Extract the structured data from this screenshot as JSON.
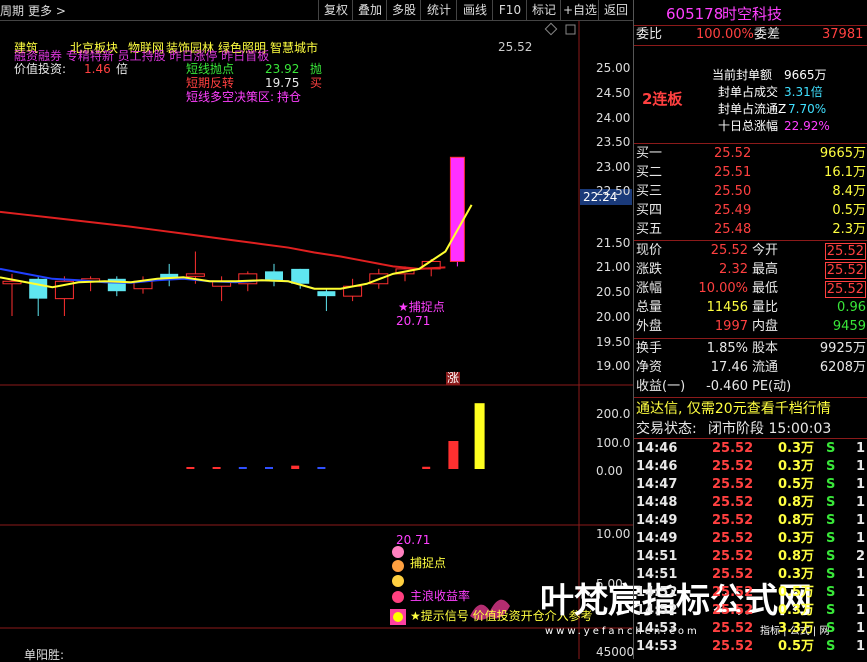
{
  "topbar": {
    "left_items": [
      "周期",
      "更多 >"
    ],
    "buttons": [
      "复权",
      "叠加",
      "多股",
      "统计",
      "画线",
      "F10",
      "标记",
      "+自选",
      "返回"
    ]
  },
  "main": {
    "sector_labels": [
      "建筑",
      "北京板块",
      "物联网",
      "装饰园林",
      "绿色照明",
      "智慧城市"
    ],
    "overlap_text": "融资融券 专精特新 员工持股 昨日涨停 昨日首板",
    "value_invest_label": "价值投资:",
    "value_invest_val": "1.46",
    "value_invest_unit": "倍",
    "sig1_label": "短线抛点",
    "sig1_val": "23.92",
    "sig1_act": "抛",
    "sig2_label": "短期反转",
    "sig2_val": "19.75",
    "sig2_act": "买",
    "sig3_label": "短线多空决策区:",
    "sig3_val": "持仓",
    "corner_price": "25.52",
    "price_axis": [
      "25.00",
      "24.50",
      "24.00",
      "23.50",
      "23.00",
      "22.50",
      "22.24",
      "21.50",
      "21.00",
      "20.50",
      "20.00",
      "19.50",
      "19.00"
    ],
    "catch_label": "★捕捉点",
    "catch_val": "20.71",
    "zhang": "涨",
    "vol_axis": [
      "200.0",
      "100.0",
      "0.00"
    ],
    "lower_axis": [
      "10.00",
      "5.00",
      "45000"
    ],
    "lower_val": "20.71",
    "lower_catch": "捕捉点",
    "lower_income": "主浪收益率",
    "lower_signal": "★提示信号 价值投资开仓介入参考",
    "bottom_left": "单阳胜:",
    "watermark": "叶梵宸指标公式网",
    "watermark_url": "www.yefanchen.com",
    "watermark_sub": "指标 | 公式 | 网"
  },
  "chart_data": {
    "type": "candlestick",
    "candles": [
      {
        "o": 20.7,
        "c": 20.65,
        "h": 20.85,
        "l": 20.0,
        "color": "red"
      },
      {
        "o": 20.75,
        "c": 20.35,
        "h": 20.8,
        "l": 20.0,
        "color": "cyan"
      },
      {
        "o": 20.35,
        "c": 20.7,
        "h": 20.8,
        "l": 20.0,
        "color": "red"
      },
      {
        "o": 20.7,
        "c": 20.75,
        "h": 20.8,
        "l": 20.5,
        "color": "red"
      },
      {
        "o": 20.75,
        "c": 20.5,
        "h": 20.8,
        "l": 20.4,
        "color": "cyan"
      },
      {
        "o": 20.55,
        "c": 20.7,
        "h": 20.8,
        "l": 20.45,
        "color": "red"
      },
      {
        "o": 20.75,
        "c": 20.85,
        "h": 21.05,
        "l": 20.6,
        "color": "cyan"
      },
      {
        "o": 20.8,
        "c": 20.85,
        "h": 21.3,
        "l": 20.65,
        "color": "red"
      },
      {
        "o": 20.7,
        "c": 20.6,
        "h": 20.8,
        "l": 20.3,
        "color": "red"
      },
      {
        "o": 20.65,
        "c": 20.85,
        "h": 20.9,
        "l": 20.5,
        "color": "red"
      },
      {
        "o": 20.9,
        "c": 20.7,
        "h": 21.05,
        "l": 20.6,
        "color": "cyan"
      },
      {
        "o": 20.95,
        "c": 20.65,
        "h": 20.95,
        "l": 20.55,
        "color": "cyan"
      },
      {
        "o": 20.5,
        "c": 20.4,
        "h": 20.55,
        "l": 20.1,
        "color": "cyan"
      },
      {
        "o": 20.4,
        "c": 20.6,
        "h": 20.75,
        "l": 20.3,
        "color": "red"
      },
      {
        "o": 20.65,
        "c": 20.85,
        "h": 20.95,
        "l": 20.55,
        "color": "red"
      },
      {
        "o": 20.85,
        "c": 20.95,
        "h": 21.0,
        "l": 20.7,
        "color": "red"
      },
      {
        "o": 20.95,
        "c": 21.1,
        "h": 21.15,
        "l": 20.8,
        "color": "red"
      },
      {
        "o": 21.1,
        "c": 23.2,
        "h": 23.2,
        "l": 21.0,
        "color": "mag"
      }
    ],
    "ma_red": [
      22.1,
      22.04,
      21.98,
      21.92,
      21.86,
      21.8,
      21.73,
      21.66,
      21.59,
      21.52,
      21.45,
      21.38,
      21.28,
      21.2,
      21.1,
      21.0,
      20.95,
      20.98
    ],
    "ma_yellow": [
      20.78,
      20.68,
      20.58,
      20.68,
      20.7,
      20.68,
      20.75,
      20.78,
      20.7,
      20.7,
      20.72,
      20.7,
      20.55,
      20.55,
      20.65,
      20.85,
      20.95,
      21.3,
      22.24
    ],
    "ma_blue": [
      20.95,
      20.85,
      20.75,
      20.72,
      20.68,
      20.67,
      20.72,
      20.75,
      20.7,
      20.68,
      20.72,
      20.7,
      20.55
    ],
    "vol_bars": [
      {
        "i": 7,
        "v": 6,
        "color": "red"
      },
      {
        "i": 8,
        "v": 4,
        "color": "red"
      },
      {
        "i": 9,
        "v": 2,
        "color": "blue"
      },
      {
        "i": 10,
        "v": 4,
        "color": "blue"
      },
      {
        "i": 11,
        "v": 12,
        "color": "red"
      },
      {
        "i": 12,
        "v": 6,
        "color": "blue"
      },
      {
        "i": 16,
        "v": 8,
        "color": "red"
      },
      {
        "i": 17,
        "v": 100,
        "color": "red"
      },
      {
        "i": 18,
        "v": 235,
        "color": "yellow"
      }
    ]
  },
  "right_panel": {
    "code": "605178",
    "name": "时空科技",
    "weibi_label": "委比",
    "weibi_val": "100.00%",
    "weicha_label": "委差",
    "weicha_val": "37981",
    "lianban": "2连板",
    "stats": [
      {
        "label": "当前封单额",
        "val": "9665万"
      },
      {
        "label": "封单占成交",
        "val": "3.31倍"
      },
      {
        "label": "封单占流通Z",
        "val": "7.70%"
      },
      {
        "label": "十日总涨幅",
        "val": "22.92%"
      }
    ],
    "bids": [
      {
        "label": "买一",
        "price": "25.52",
        "vol": "9665万"
      },
      {
        "label": "买二",
        "price": "25.51",
        "vol": "16.1万"
      },
      {
        "label": "买三",
        "price": "25.50",
        "vol": "8.4万"
      },
      {
        "label": "买四",
        "price": "25.49",
        "vol": "0.5万"
      },
      {
        "label": "买五",
        "price": "25.48",
        "vol": "2.3万"
      }
    ],
    "quote": [
      {
        "l1": "现价",
        "v1": "25.52",
        "l2": "今开",
        "v2": "25.52"
      },
      {
        "l1": "涨跌",
        "v1": "2.32",
        "l2": "最高",
        "v2": "25.52"
      },
      {
        "l1": "涨幅",
        "v1": "10.00%",
        "l2": "最低",
        "v2": "25.52"
      },
      {
        "l1": "总量",
        "v1": "11456",
        "l2": "量比",
        "v2": "0.96"
      },
      {
        "l1": "外盘",
        "v1": "1997",
        "l2": "内盘",
        "v2": "9459"
      }
    ],
    "fund": [
      {
        "l1": "换手",
        "v1": "1.85%",
        "l2": "股本",
        "v2": "9925万"
      },
      {
        "l1": "净资",
        "v1": "17.46",
        "l2": "流通",
        "v2": "6208万"
      },
      {
        "l1": "收益(一)",
        "v1": "-0.460",
        "l2": "PE(动)",
        "v2": ""
      }
    ],
    "notice": "通达信, 仅需20元查看千档行情",
    "status_label": "交易状态:",
    "status_val": "闭市阶段 15:00:03",
    "ticks": [
      {
        "t": "14:46",
        "p": "25.52",
        "v": "0.3万",
        "s": "S",
        "n": "1"
      },
      {
        "t": "14:46",
        "p": "25.52",
        "v": "0.3万",
        "s": "S",
        "n": "1"
      },
      {
        "t": "14:47",
        "p": "25.52",
        "v": "0.5万",
        "s": "S",
        "n": "1"
      },
      {
        "t": "14:48",
        "p": "25.52",
        "v": "0.8万",
        "s": "S",
        "n": "1"
      },
      {
        "t": "14:49",
        "p": "25.52",
        "v": "0.8万",
        "s": "S",
        "n": "1"
      },
      {
        "t": "14:49",
        "p": "25.52",
        "v": "0.3万",
        "s": "S",
        "n": "1"
      },
      {
        "t": "14:51",
        "p": "25.52",
        "v": "0.8万",
        "s": "S",
        "n": "2"
      },
      {
        "t": "14:51",
        "p": "25.52",
        "v": "0.3万",
        "s": "S",
        "n": "1"
      },
      {
        "t": "14:52",
        "p": "25.52",
        "v": "0.5万",
        "s": "S",
        "n": "1"
      },
      {
        "t": "14:52",
        "p": "25.52",
        "v": "0.3万",
        "s": "S",
        "n": "1"
      },
      {
        "t": "14:53",
        "p": "25.52",
        "v": "3.3万",
        "s": "S",
        "n": "1"
      },
      {
        "t": "14:53",
        "p": "25.52",
        "v": "0.5万",
        "s": "S",
        "n": "1"
      }
    ]
  }
}
